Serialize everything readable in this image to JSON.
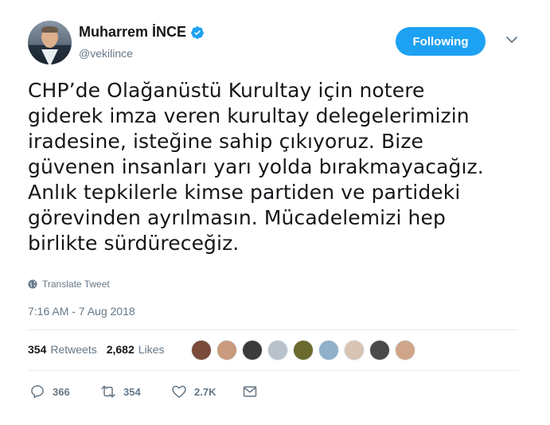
{
  "user": {
    "display_name": "Muharrem İNCE",
    "handle": "@vekilince"
  },
  "follow_button": {
    "label": "Following"
  },
  "tweet": {
    "text": "CHP’de Olağanüstü Kurultay için notere\ngiderek imza veren kurultay delegelerimizin\niradesine, isteğine sahip çıkıyoruz. Bize\ngüvenen insanları yarı yolda bırakmayacağız.\nAnlık tepkilerle kimse partiden ve partideki\ngörevinden ayrılmasın. Mücadelemizi hep\nbirlikte sürdüreceğiz.",
    "translate_label": "Translate Tweet",
    "timestamp": "7:16 AM - 7 Aug 2018"
  },
  "stats": {
    "retweets_count": "354",
    "retweets_label": "Retweets",
    "likes_count": "2,682",
    "likes_label": "Likes"
  },
  "likers": [
    {
      "color": "#7a4a3a"
    },
    {
      "color": "#c99a7c"
    },
    {
      "color": "#3b3b3b"
    },
    {
      "color": "#b9c2ca"
    },
    {
      "color": "#6b6a2e"
    },
    {
      "color": "#8fb0c8"
    },
    {
      "color": "#d8c4b2"
    },
    {
      "color": "#4a4a4a"
    },
    {
      "color": "#cfa58a"
    }
  ],
  "actions": {
    "replies": "366",
    "retweets": "354",
    "likes": "2.7K"
  },
  "colors": {
    "accent": "#1da1f2",
    "muted": "#657786",
    "text": "#14171a"
  }
}
